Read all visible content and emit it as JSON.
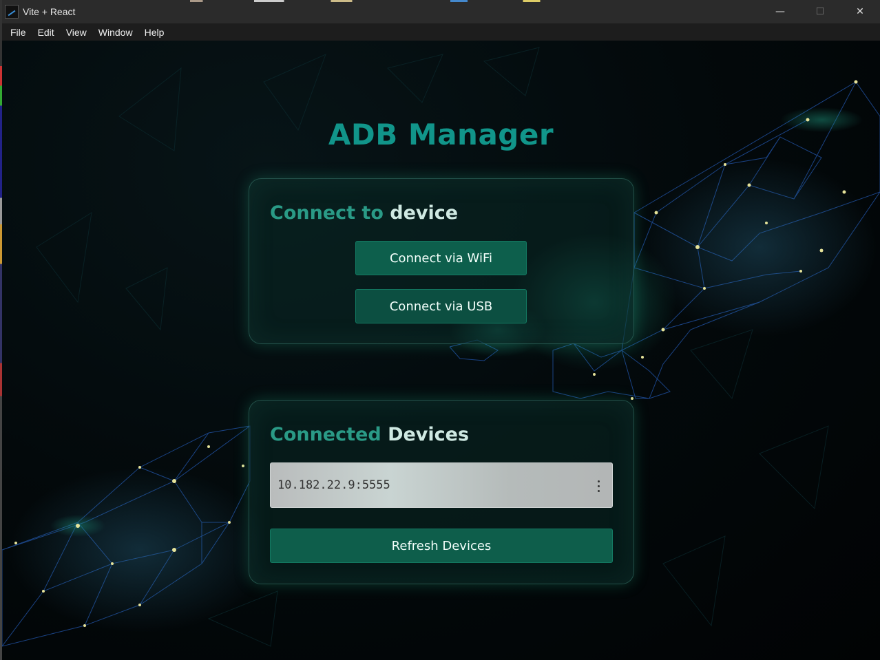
{
  "window": {
    "title": "Vite + React",
    "controls": {
      "minimize": "—",
      "maximize": "☐",
      "close": "✕"
    }
  },
  "menu": [
    "File",
    "Edit",
    "View",
    "Window",
    "Help"
  ],
  "app": {
    "title": "ADB Manager"
  },
  "connect_card": {
    "heading_part1": "Connect",
    "heading_part2": " to ",
    "heading_part3": "device",
    "wifi_button": "Connect via WiFi",
    "usb_button": "Connect via USB"
  },
  "devices_card": {
    "heading_part1": "Connected",
    "heading_part2": " Devices",
    "devices": [
      {
        "id": "10.182.22.9:5555"
      }
    ],
    "refresh_button": "Refresh Devices"
  },
  "colors": {
    "accent": "#11958a",
    "button": "#0d5f4c",
    "background": "#03090b"
  },
  "icons": [
    "app-logo-icon",
    "minimize-icon",
    "maximize-icon",
    "close-icon",
    "kebab-menu-icon"
  ]
}
